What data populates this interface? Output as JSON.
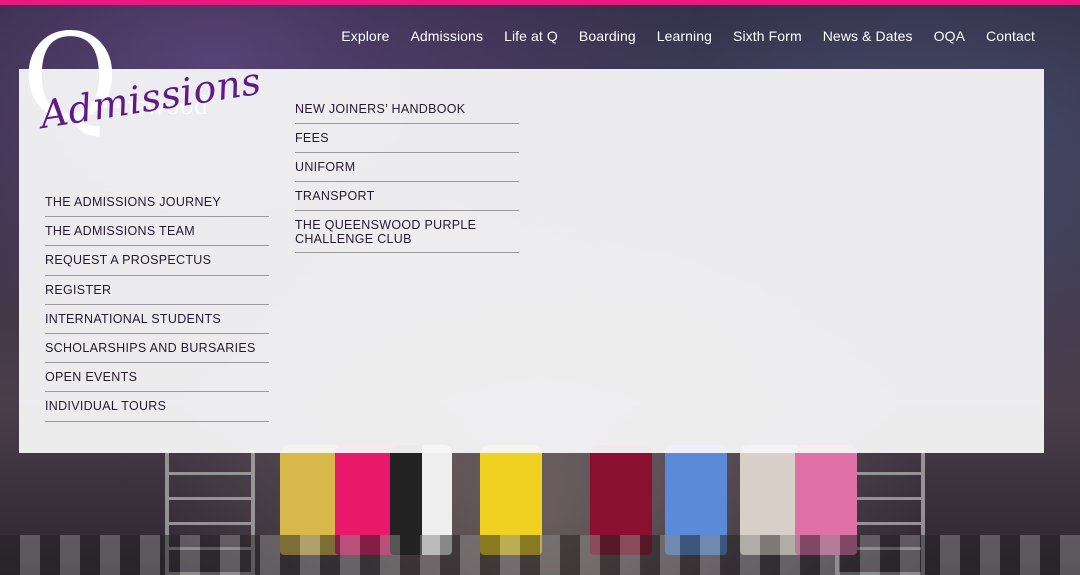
{
  "nav": {
    "items": [
      "Explore",
      "Admissions",
      "Life at Q",
      "Boarding",
      "Learning",
      "Sixth Form",
      "News & Dates",
      "OQA",
      "Contact"
    ]
  },
  "logo": {
    "letter": "Q",
    "wordmark": "ueenswood",
    "section_script": "Admissions"
  },
  "menu": {
    "column1": [
      "THE ADMISSIONS JOURNEY",
      "THE ADMISSIONS TEAM",
      "REQUEST A PROSPECTUS",
      "REGISTER",
      "INTERNATIONAL STUDENTS",
      "SCHOLARSHIPS AND BURSARIES",
      "OPEN EVENTS",
      "INDIVIDUAL TOURS"
    ],
    "column2": [
      "NEW JOINERS’ HANDBOOK",
      "FEES",
      "UNIFORM",
      "TRANSPORT",
      "THE QUEENSWOOD PURPLE CHALLENGE CLUB"
    ]
  },
  "colors": {
    "accent_bar": "#e8197f",
    "script_purple": "#5f1a86"
  }
}
